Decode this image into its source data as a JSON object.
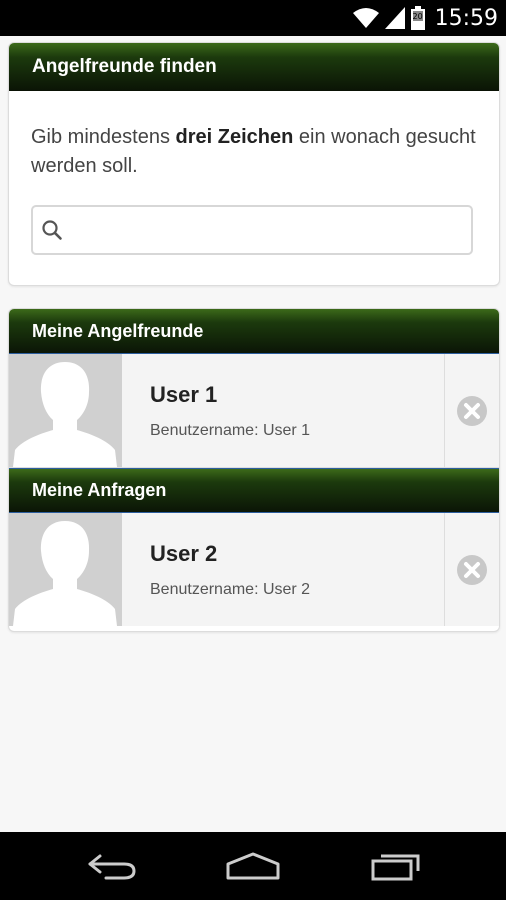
{
  "status_bar": {
    "time": "15:59",
    "battery_level": "20",
    "icons": [
      "wifi-icon",
      "signal-icon",
      "battery-icon"
    ]
  },
  "search_card": {
    "title": "Angelfreunde finden",
    "description_prefix": "Gib mindestens ",
    "description_bold": "drei Zeichen",
    "description_suffix": " ein wonach gesucht werden soll.",
    "search_value": "",
    "search_placeholder": ""
  },
  "friends": {
    "header": "Meine Angelfreunde",
    "items": [
      {
        "name": "User 1",
        "username_label": "Benutzername: User 1"
      }
    ]
  },
  "requests": {
    "header": "Meine Anfragen",
    "items": [
      {
        "name": "User 2",
        "username_label": "Benutzername: User 2"
      }
    ]
  },
  "nav_bar": {
    "buttons": [
      "back-icon",
      "home-icon",
      "recent-apps-icon"
    ]
  },
  "colors": {
    "header_gradient_top": "#3c6a1a",
    "header_gradient_bottom": "#0b1506",
    "section_border": "#2c5e9e",
    "background": "#f7f7f7"
  }
}
